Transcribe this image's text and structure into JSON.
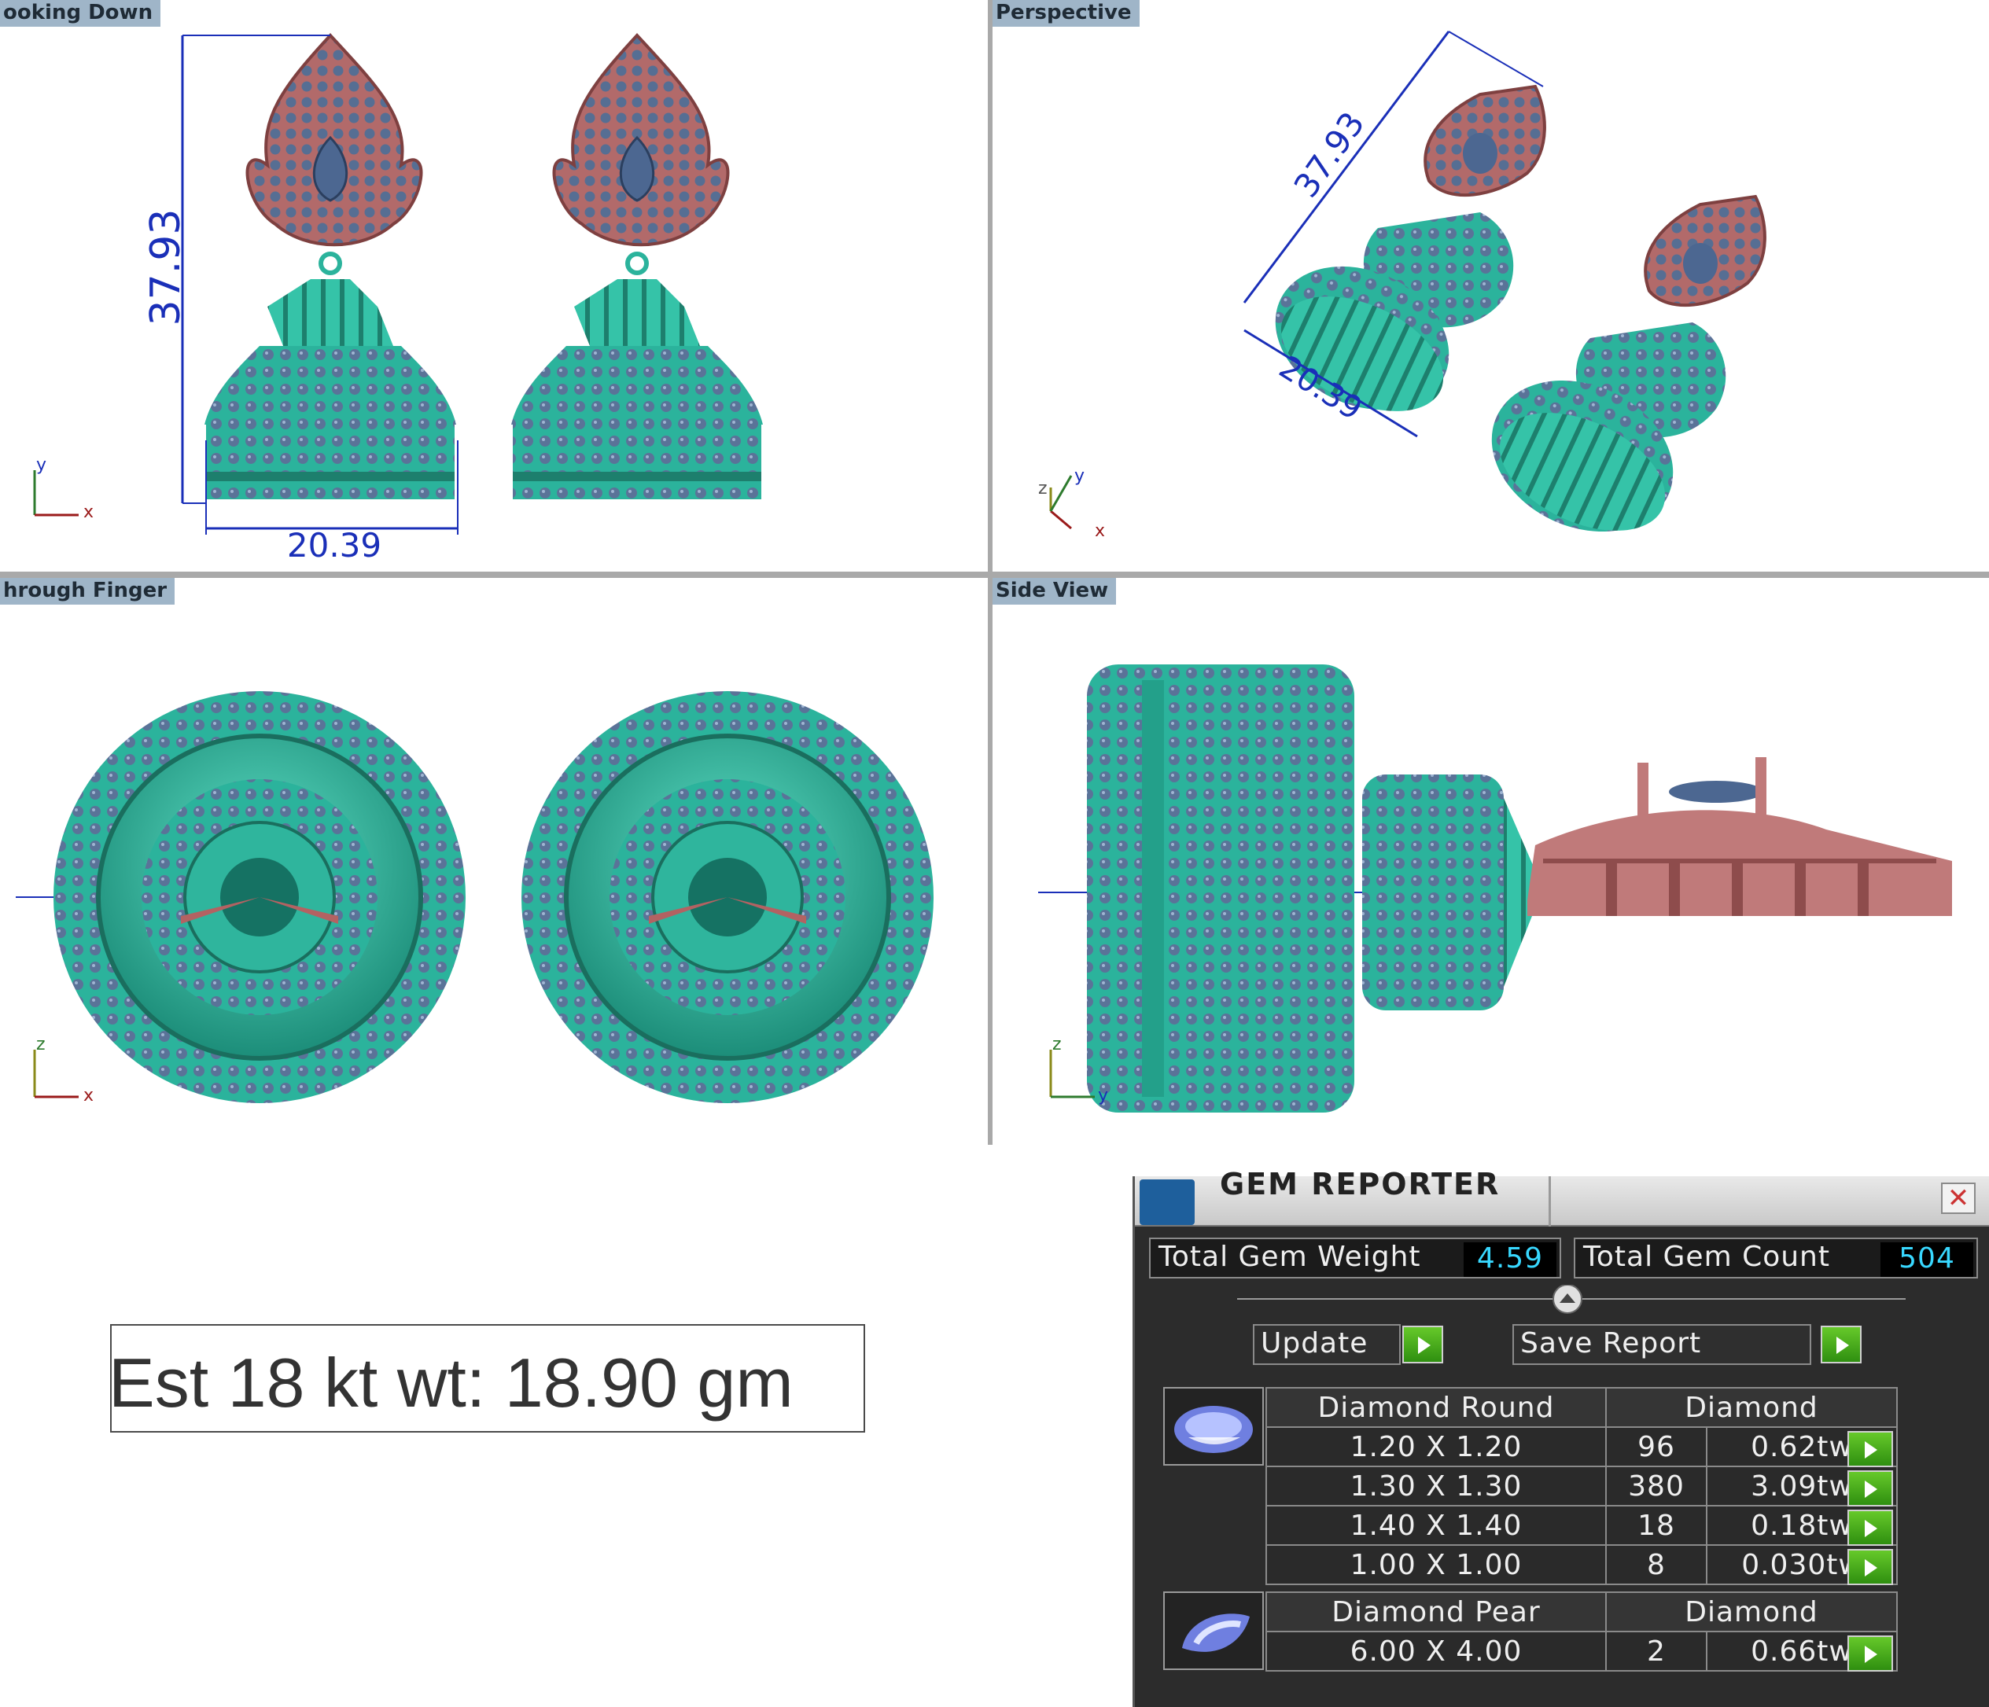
{
  "viewports": {
    "top_left": {
      "label": "ooking Down",
      "dim_height": "37.93",
      "dim_width": "20.39",
      "axis_y": "y",
      "axis_x": "x"
    },
    "top_right": {
      "label": "Perspective",
      "dim_height": "37.93",
      "dim_width": "20.39",
      "axis_z": "z",
      "axis_y": "y",
      "axis_x": "x"
    },
    "bottom_left": {
      "label": "hrough Finger",
      "axis_z": "z",
      "axis_x": "x"
    },
    "bottom_right": {
      "label": "Side View",
      "axis_z": "z",
      "axis_y": "y"
    }
  },
  "estimate": {
    "text": "Est 18 kt wt: 18.90 gm"
  },
  "gem_reporter": {
    "title": "GEM REPORTER",
    "close_label": "✕",
    "total_weight_label": "Total Gem Weight",
    "total_weight_value": "4.59",
    "total_count_label": "Total Gem Count",
    "total_count_value": "504",
    "update_label": "Update",
    "save_report_label": "Save Report",
    "groups": [
      {
        "shape": "Diamond Round",
        "material": "Diamond",
        "rows": [
          {
            "size": "1.20 X 1.20",
            "count": "96",
            "weight": "0.62tw"
          },
          {
            "size": "1.30 X 1.30",
            "count": "380",
            "weight": "3.09tw"
          },
          {
            "size": "1.40 X 1.40",
            "count": "18",
            "weight": "0.18tw"
          },
          {
            "size": "1.00 X 1.00",
            "count": "8",
            "weight": "0.030tw"
          }
        ]
      },
      {
        "shape": "Diamond Pear",
        "material": "Diamond",
        "rows": [
          {
            "size": "6.00 X 4.00",
            "count": "2",
            "weight": "0.66tw"
          }
        ]
      }
    ]
  }
}
